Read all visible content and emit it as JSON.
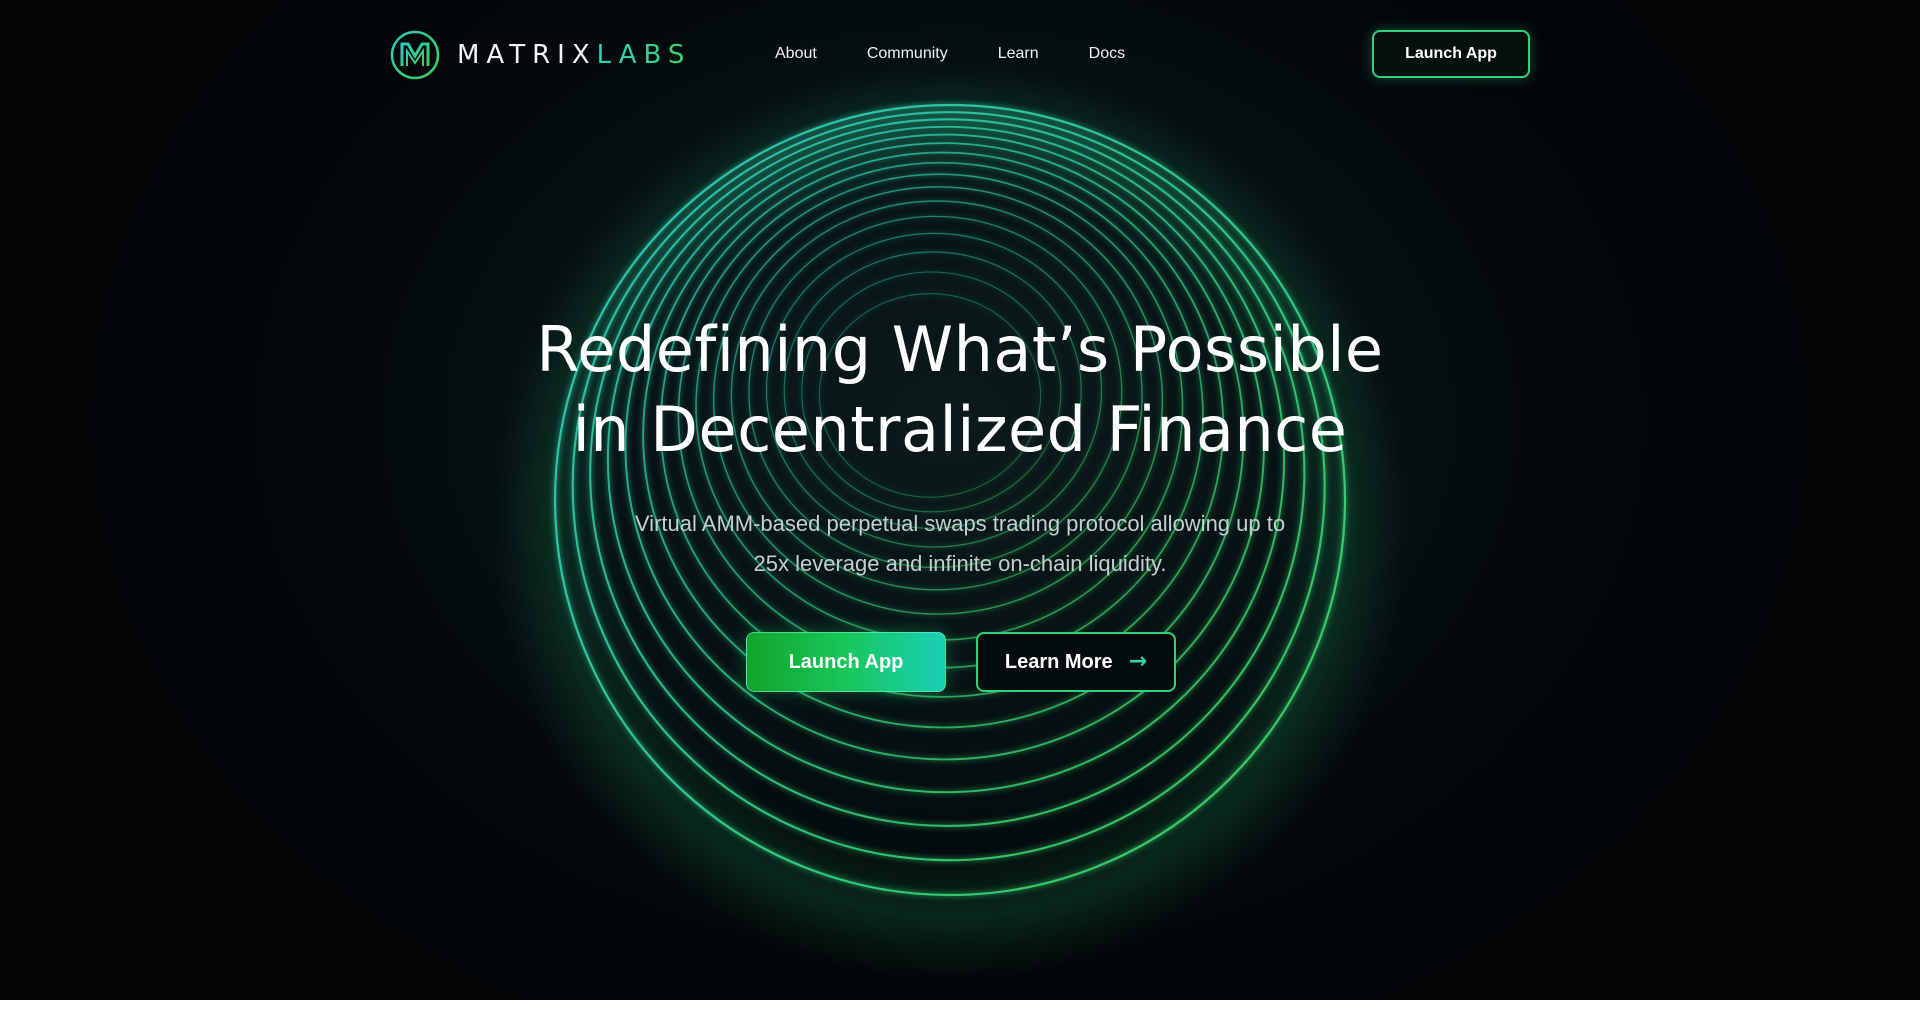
{
  "brand": {
    "name_part1": "MATRIX",
    "name_part2": "LABS",
    "logo_icon": "matrix-m-logo-icon"
  },
  "nav": {
    "links": [
      "About",
      "Community",
      "Learn",
      "Docs"
    ],
    "launch_label": "Launch App"
  },
  "hero": {
    "title_line1": "Redefining What’s Possible",
    "title_line2": "in Decentralized Finance",
    "subtitle_line1": "Virtual AMM-based perpetual swaps trading protocol allowing up to",
    "subtitle_line2": "25x leverage and infinite on-chain liquidity.",
    "primary_label": "Launch App",
    "secondary_label": "Learn More",
    "secondary_icon": "arrow-right-icon"
  },
  "colors": {
    "background": "#03070a",
    "accent_green": "#2fd17c",
    "accent_teal": "#2ad0c4",
    "text_primary": "#ffffff",
    "text_muted": "#c3cfd0"
  }
}
